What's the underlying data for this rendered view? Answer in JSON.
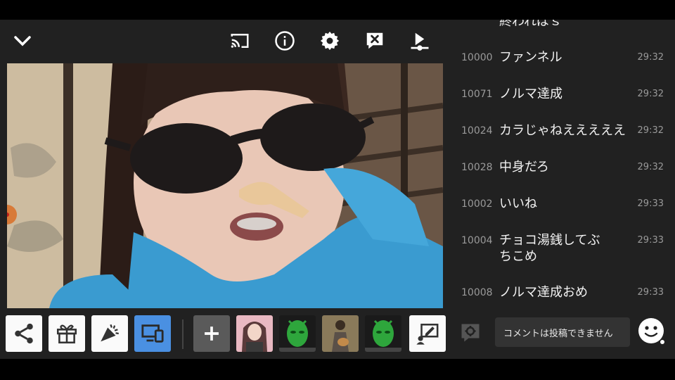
{
  "toolbar": {
    "icons": [
      "chevron-down-icon",
      "cast-icon",
      "info-icon",
      "settings-icon",
      "comment-off-icon",
      "upload-icon"
    ]
  },
  "comments": {
    "partial_top": "終わればｓ",
    "items": [
      {
        "no": "10000",
        "text": "ファンネル",
        "time": "29:32"
      },
      {
        "no": "10071",
        "text": "ノルマ達成",
        "time": "29:32"
      },
      {
        "no": "10024",
        "text": "カラじゃねえええええ",
        "time": "29:32"
      },
      {
        "no": "10028",
        "text": "中身だろ",
        "time": "29:32"
      },
      {
        "no": "10002",
        "text": "いいね",
        "time": "29:33"
      },
      {
        "no": "10004",
        "text": "チョコ湯銭してぶちこめ",
        "time": "29:33"
      },
      {
        "no": "10008",
        "text": "ノルマ達成おめ",
        "time": "29:33"
      }
    ]
  },
  "bottombar": {
    "buttons": [
      "share-icon",
      "gift-icon",
      "cheer-icon",
      "devices-icon",
      "plus-icon"
    ],
    "thumbnails": [
      "girl-avatar",
      "green-mask-avatar",
      "guitar-avatar",
      "green-mask-avatar-2"
    ],
    "edit": "edit-note-icon"
  },
  "input": {
    "placeholder": "コメントは投稿できません"
  },
  "colors": {
    "panel_bg": "#212121",
    "active_blue": "#4a90e2",
    "text_primary": "#f2f2f2",
    "text_secondary": "#9a9a9a"
  }
}
